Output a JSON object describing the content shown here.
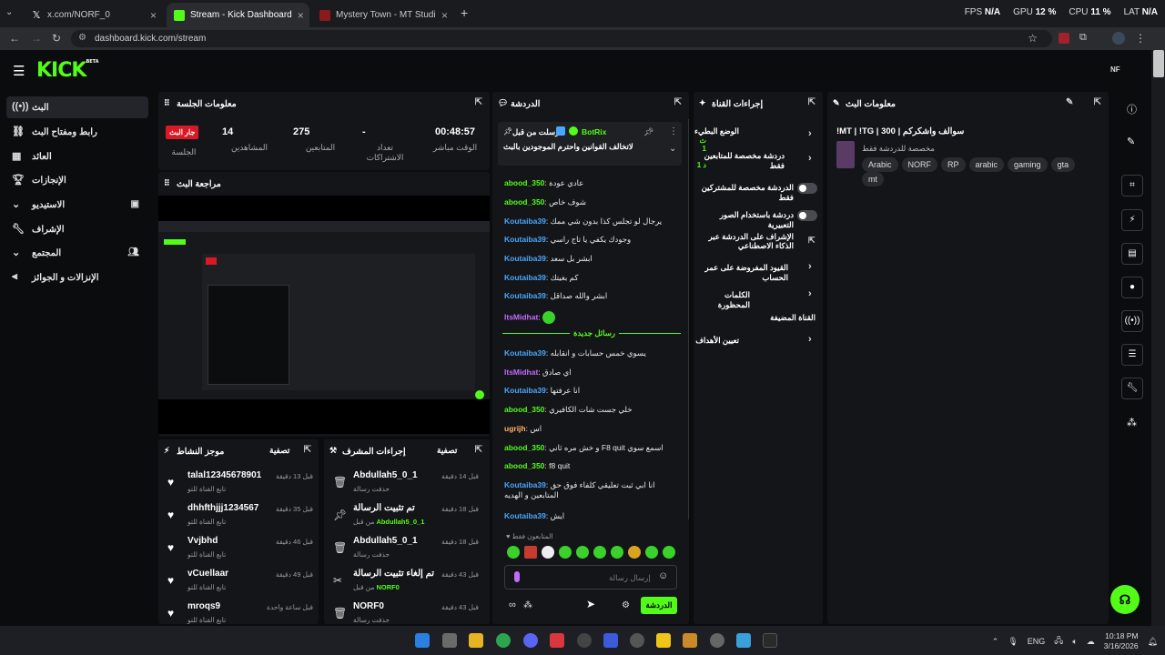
{
  "browser": {
    "tabs": [
      {
        "title": "x.com/NORF_0",
        "favicon": "x-icon"
      },
      {
        "title": "Stream - Kick Dashboard",
        "favicon": "kick-icon",
        "active": true
      },
      {
        "title": "Mystery Town - MT Studios | M",
        "favicon": "mt-icon"
      }
    ],
    "url": "dashboard.kick.com/stream",
    "perf": {
      "fps_label": "FPS",
      "fps": "N/A",
      "gpu_label": "GPU",
      "gpu": "12 %",
      "cpu_label": "CPU",
      "cpu": "11 %",
      "lat_label": "LAT",
      "lat": "N/A"
    }
  },
  "app": {
    "logo": "KICK",
    "logo_sup": "BETA",
    "profile": "NF"
  },
  "sidebar": {
    "items": [
      {
        "label": "البث",
        "icon": "live-icon"
      },
      {
        "label": "رابط ومفتاح البث",
        "icon": "link-icon"
      },
      {
        "label": "العائد",
        "icon": "bank-icon"
      },
      {
        "label": "الإنجازات",
        "icon": "trophy-icon"
      },
      {
        "label": "الاستيديو",
        "icon": "studio-icon"
      },
      {
        "label": "الإشراف",
        "icon": "wrench-icon"
      },
      {
        "label": "المجتمع",
        "icon": "community-icon"
      },
      {
        "label": "الإنزالات و الجوائز",
        "icon": "drops-icon"
      }
    ]
  },
  "session": {
    "title": "معلومات الجلسة",
    "live_badge": "جار البث",
    "session_label": "الجلسة",
    "stats": [
      {
        "value": "14",
        "label": "المشاهدين"
      },
      {
        "value": "275",
        "label": "المتابعين"
      },
      {
        "value": "-",
        "label": "تعداد الاشتراكات"
      },
      {
        "value": "00:48:57",
        "label": "الوقت مباشر"
      }
    ]
  },
  "preview": {
    "title": "مراجعة البث"
  },
  "activity": {
    "title": "موجز النشاط",
    "filter": "تصفية",
    "items": [
      {
        "name": "talal12345678901",
        "sub": "تابع القناة للتو",
        "time": "قبل 13 دقيقة"
      },
      {
        "name": "dhhfthjjj1234567",
        "sub": "تابع القناة للتو",
        "time": "قبل 35 دقيقة"
      },
      {
        "name": "Vvjbhd",
        "sub": "تابع القناة للتو",
        "time": "قبل 46 دقيقة"
      },
      {
        "name": "vCuellaar",
        "sub": "تابع القناة للتو",
        "time": "قبل 49 دقيقة"
      },
      {
        "name": "mroqs9",
        "sub": "تابع القناة للتو",
        "time": "قبل ساعة واحدة"
      }
    ]
  },
  "modactions": {
    "title": "إجراءات المشرف",
    "filter": "تصفية",
    "items": [
      {
        "name": "Abdullah5_0_1",
        "sub": "حذفت رسالة",
        "by": "",
        "time": "قبل 14 دقيقة",
        "icon": "trash-icon"
      },
      {
        "name": "تم تثبيت الرسالة",
        "sub": "من قبل",
        "by": "Abdullah5_0_1",
        "time": "قبل 18 دقيقة",
        "icon": "pin-icon"
      },
      {
        "name": "Abdullah5_0_1",
        "sub": "حذفت رسالة",
        "by": "",
        "time": "قبل 18 دقيقة",
        "icon": "trash-icon"
      },
      {
        "name": "تم إلغاء تثبيت الرسالة",
        "sub": "من قبل",
        "by": "NORF0",
        "time": "قبل 43 دقيقة",
        "icon": "unpin-icon"
      },
      {
        "name": "NORF0",
        "sub": "حذفت رسالة",
        "by": "",
        "time": "قبل 43 دقيقة",
        "icon": "trash-icon"
      }
    ]
  },
  "chat": {
    "title": "الدردشة",
    "pinned_header": "أرسلت من قبل",
    "pinned_user": "BotRix",
    "pinned_text": "لاتخالف القوانين واحترم الموجودين بالبث",
    "new_messages": "رسائل جديدة",
    "followers_only": "المتابعون فقط",
    "input_placeholder": "إرسال رسالة",
    "send_button": "الدردشة",
    "messages": [
      {
        "user": "abood_350",
        "text": "عادي عودة",
        "color": "green"
      },
      {
        "user": "abood_350",
        "text": "شوف خاص",
        "color": "green"
      },
      {
        "user": "Koutaiba39",
        "text": "يرجال لو تجلس كذا بدون شي ممك",
        "color": "blue"
      },
      {
        "user": "Koutaiba39",
        "text": "وجودك يكفي يا تاج راسي",
        "color": "blue"
      },
      {
        "user": "Koutaiba39",
        "text": "ابشر بل سعد",
        "color": "blue"
      },
      {
        "user": "Koutaiba39",
        "text": "كم بغيتك",
        "color": "blue"
      },
      {
        "user": "Koutaiba39",
        "text": "ابشر والله صداقل",
        "color": "blue"
      },
      {
        "user": "ItsMidhat",
        "text": "",
        "color": "purple"
      },
      {
        "user": "Koutaiba39",
        "text": "يسوي خمس حسابات و انقابله",
        "color": "blue"
      },
      {
        "user": "ItsMidhat",
        "text": "اي صادق",
        "color": "purple"
      },
      {
        "user": "Koutaiba39",
        "text": "انا عرفتها",
        "color": "blue"
      },
      {
        "user": "abood_350",
        "text": "خلي جست شات الكافيري",
        "color": "green"
      },
      {
        "user": "ugrijh",
        "text": "اس",
        "color": "orange"
      },
      {
        "user": "abood_350",
        "text": "و خش مره ثاني F8 quit اسمع سوي",
        "color": "green"
      },
      {
        "user": "abood_350",
        "text": "f8 quit",
        "color": "green"
      },
      {
        "user": "Koutaiba39",
        "text": "انا ابي ثبت تعليقي كلفاء فوق حق المتابعين و الهديه",
        "color": "blue"
      },
      {
        "user": "Koutaiba39",
        "text": "ايش",
        "color": "blue"
      }
    ]
  },
  "channel_actions": {
    "title": "إجراءات القناة",
    "items": [
      {
        "label": "الوضع البطيء",
        "sub": "ث 1",
        "type": "arrow"
      },
      {
        "label": "دردشة مخصصة للمتابعين فقط",
        "sub": "د 1",
        "type": "arrow"
      },
      {
        "label": "الدردشة مخصصة للمشتركين فقط",
        "sub": "",
        "type": "toggle"
      },
      {
        "label": "دردشة باستخدام الصور التعبيرية",
        "sub": "",
        "type": "toggle"
      },
      {
        "label": "الإشراف على الدردشة عبر الذكاء الاصطناعي",
        "sub": "",
        "type": "external"
      },
      {
        "label": "القيود المفروضة على عمر الحساب",
        "sub": "",
        "type": "arrow"
      },
      {
        "label": "الكلمات المحظورة",
        "sub": "",
        "type": "arrow"
      },
      {
        "label": "القناة المضيفة",
        "sub": "",
        "type": "none"
      },
      {
        "label": "تعيين الأهداف",
        "sub": "",
        "type": "arrow"
      }
    ]
  },
  "stream_info": {
    "title": "معلومات البث",
    "stream_title": "!MT | !TG | 300 | سوالف واشكركم",
    "category": "مخصصة للدردشة فقط",
    "tags": [
      "Arabic",
      "NORF",
      "RP",
      "arabic",
      "gaming",
      "gta",
      "mt"
    ]
  },
  "taskbar": {
    "lang": "ENG",
    "time": "10:18 PM",
    "date": "3/16/2026"
  }
}
